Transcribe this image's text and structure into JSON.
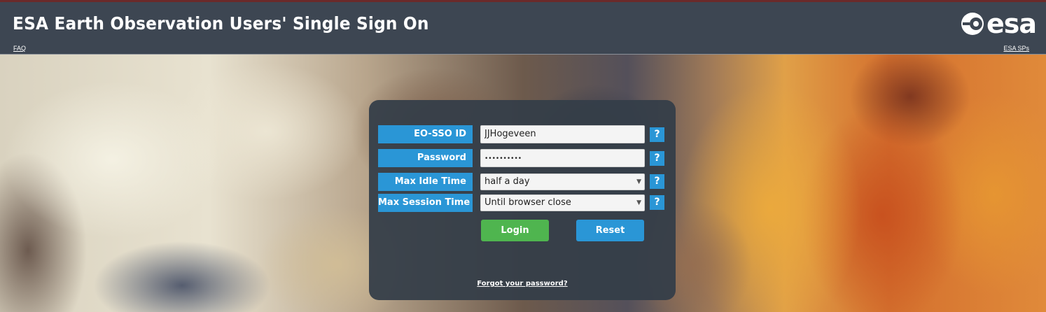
{
  "header": {
    "title": "ESA Earth Observation Users' Single Sign On",
    "faq_link": "FAQ",
    "esa_sps_link": "ESA SPs",
    "logo_text": "esa",
    "logo_icon": "esa-logo-icon"
  },
  "form": {
    "fields": [
      {
        "label": "EO-SSO ID",
        "value": "JJHogeveen",
        "help": "?"
      },
      {
        "label": "Password",
        "value": "••••••••••",
        "help": "?"
      },
      {
        "label": "Max Idle Time",
        "value": "half a day",
        "help": "?"
      },
      {
        "label": "Max Session Time",
        "value": "Until browser close",
        "help": "?"
      }
    ],
    "login_label": "Login",
    "reset_label": "Reset",
    "forgot_label": "Forgot your password?"
  },
  "colors": {
    "header_bg": "#3d4652",
    "label_bg": "#2a96d6",
    "login_bg": "#4fb54f",
    "reset_bg": "#2a96d6",
    "panel_bg": "#343e48"
  }
}
